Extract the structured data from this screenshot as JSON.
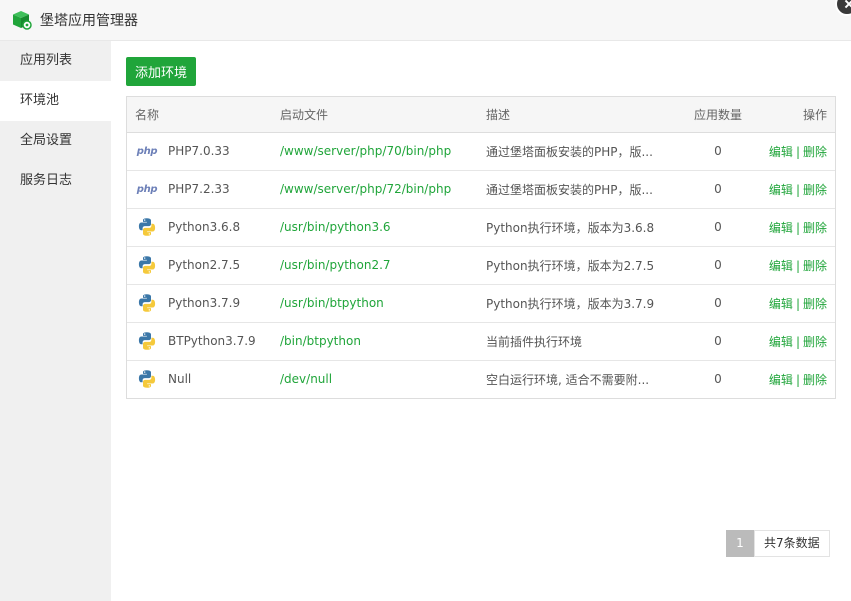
{
  "window": {
    "title": "堡塔应用管理器",
    "logo_icon": "bt-box-icon",
    "close_icon": "close-icon"
  },
  "sidebar": {
    "items": [
      {
        "label": "应用列表",
        "active": false
      },
      {
        "label": "环境池",
        "active": true
      },
      {
        "label": "全局设置",
        "active": false
      },
      {
        "label": "服务日志",
        "active": false
      }
    ]
  },
  "toolbar": {
    "add_label": "添加环境"
  },
  "table": {
    "headers": {
      "name": "名称",
      "path": "启动文件",
      "desc": "描述",
      "count": "应用数量",
      "ops": "操作"
    },
    "rows": [
      {
        "icon": "php-icon",
        "name": "PHP7.0.33",
        "path": "/www/server/php/70/bin/php",
        "desc": "通过堡塔面板安装的PHP，版...",
        "count": "0",
        "edit": "编辑",
        "delete": "删除"
      },
      {
        "icon": "php-icon",
        "name": "PHP7.2.33",
        "path": "/www/server/php/72/bin/php",
        "desc": "通过堡塔面板安装的PHP，版...",
        "count": "0",
        "edit": "编辑",
        "delete": "删除"
      },
      {
        "icon": "python-icon",
        "name": "Python3.6.8",
        "path": "/usr/bin/python3.6",
        "desc": "Python执行环境，版本为3.6.8",
        "count": "0",
        "edit": "编辑",
        "delete": "删除"
      },
      {
        "icon": "python-icon",
        "name": "Python2.7.5",
        "path": "/usr/bin/python2.7",
        "desc": "Python执行环境，版本为2.7.5",
        "count": "0",
        "edit": "编辑",
        "delete": "删除"
      },
      {
        "icon": "python-icon",
        "name": "Python3.7.9",
        "path": "/usr/bin/btpython",
        "desc": "Python执行环境，版本为3.7.9",
        "count": "0",
        "edit": "编辑",
        "delete": "删除"
      },
      {
        "icon": "python-icon",
        "name": "BTPython3.7.9",
        "path": "/bin/btpython",
        "desc": "当前插件执行环境",
        "count": "0",
        "edit": "编辑",
        "delete": "删除"
      },
      {
        "icon": "python-icon",
        "name": "Null",
        "path": "/dev/null",
        "desc": "空白运行环境, 适合不需要附...",
        "count": "0",
        "edit": "编辑",
        "delete": "删除"
      }
    ]
  },
  "pagination": {
    "current": "1",
    "total_text": "共7条数据"
  },
  "colors": {
    "accent": "#20a53a",
    "php": "#6d80b8",
    "python_blue": "#3b77a8",
    "python_yellow": "#f5c93b"
  }
}
